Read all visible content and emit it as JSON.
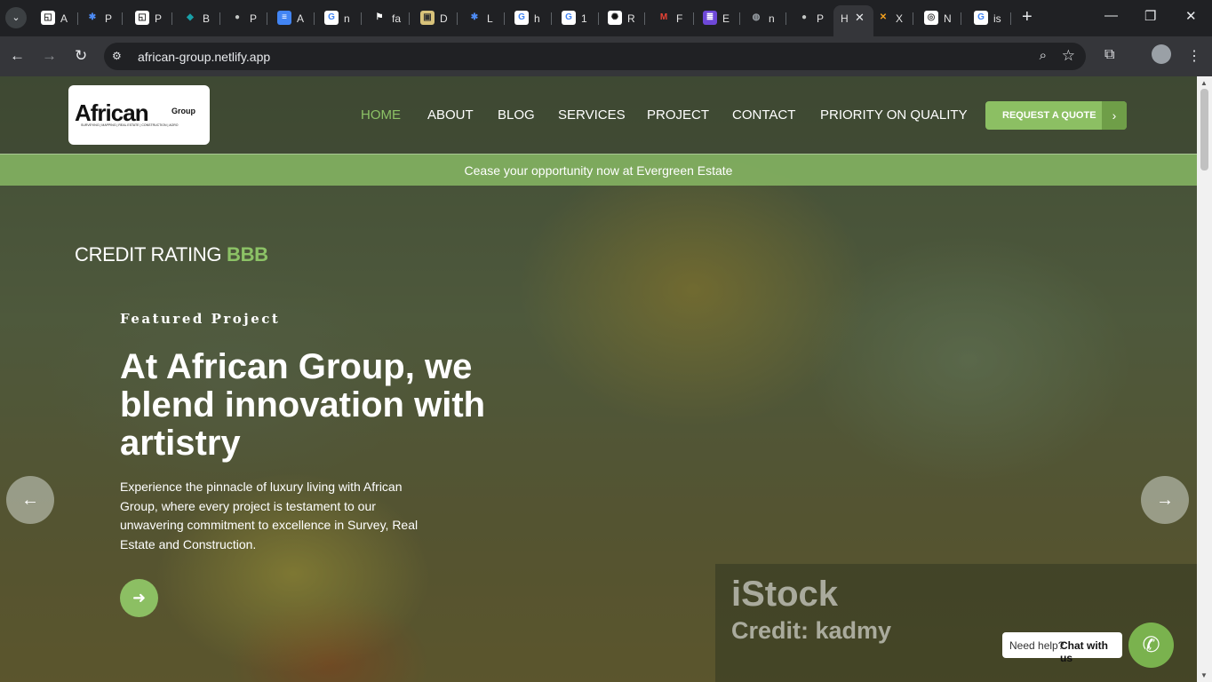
{
  "browser": {
    "tabs": [
      {
        "icon": "doc-icon",
        "title": "A"
      },
      {
        "icon": "flower-icon",
        "title": "P"
      },
      {
        "icon": "doc-icon",
        "title": "P"
      },
      {
        "icon": "diamond-icon",
        "title": "B"
      },
      {
        "icon": "github-icon",
        "title": "P"
      },
      {
        "icon": "docs-icon",
        "title": "A"
      },
      {
        "icon": "google-icon",
        "title": "n"
      },
      {
        "icon": "flag-icon",
        "title": "fa"
      },
      {
        "icon": "lock-icon",
        "title": "D"
      },
      {
        "icon": "flower-icon",
        "title": "L"
      },
      {
        "icon": "google-icon",
        "title": "h"
      },
      {
        "icon": "google-icon",
        "title": "1"
      },
      {
        "icon": "openai-icon",
        "title": "R"
      },
      {
        "icon": "gmail-icon",
        "title": "F"
      },
      {
        "icon": "list-icon",
        "title": "E"
      },
      {
        "icon": "globe-icon",
        "title": "n"
      },
      {
        "icon": "github-icon",
        "title": "P"
      },
      {
        "icon": "none",
        "title": "H"
      },
      {
        "icon": "x-icon",
        "title": "X"
      },
      {
        "icon": "chrome-icon",
        "title": "N"
      },
      {
        "icon": "google-icon",
        "title": "is"
      }
    ],
    "url": "african-group.netlify.app"
  },
  "site": {
    "logo": {
      "main": "African",
      "sub": "Group",
      "tagline": "SURVEYING | MAPPING | REAL ESTATE | CONSTRUCTION | AGRO"
    },
    "nav": [
      "HOME",
      "ABOUT",
      "BLOG",
      "SERVICES",
      "PROJECT",
      "CONTACT",
      "PRIORITY ON QUALITY"
    ],
    "quote_button": "REQUEST A QUOTE",
    "promo_text": "Cease your opportunity now at Evergreen Estate",
    "credit_label": "CREDIT RATING",
    "credit_value": "BBB",
    "featured": "Featured Project",
    "headline": "At African Group, we blend innovation with artistry",
    "description": "Experience the pinnacle of luxury living with African Group, where every project is testament to our unwavering commitment to excellence in Survey, Real Estate and Construction.",
    "watermark": {
      "brand": "iStock",
      "credit": "Credit: kadmy"
    },
    "help": {
      "prefix": "Need help?",
      "action": "Chat with us"
    }
  },
  "colors": {
    "accent": "#8cbf63",
    "chrome_bg": "#202124",
    "toolbar_bg": "#35363a"
  }
}
